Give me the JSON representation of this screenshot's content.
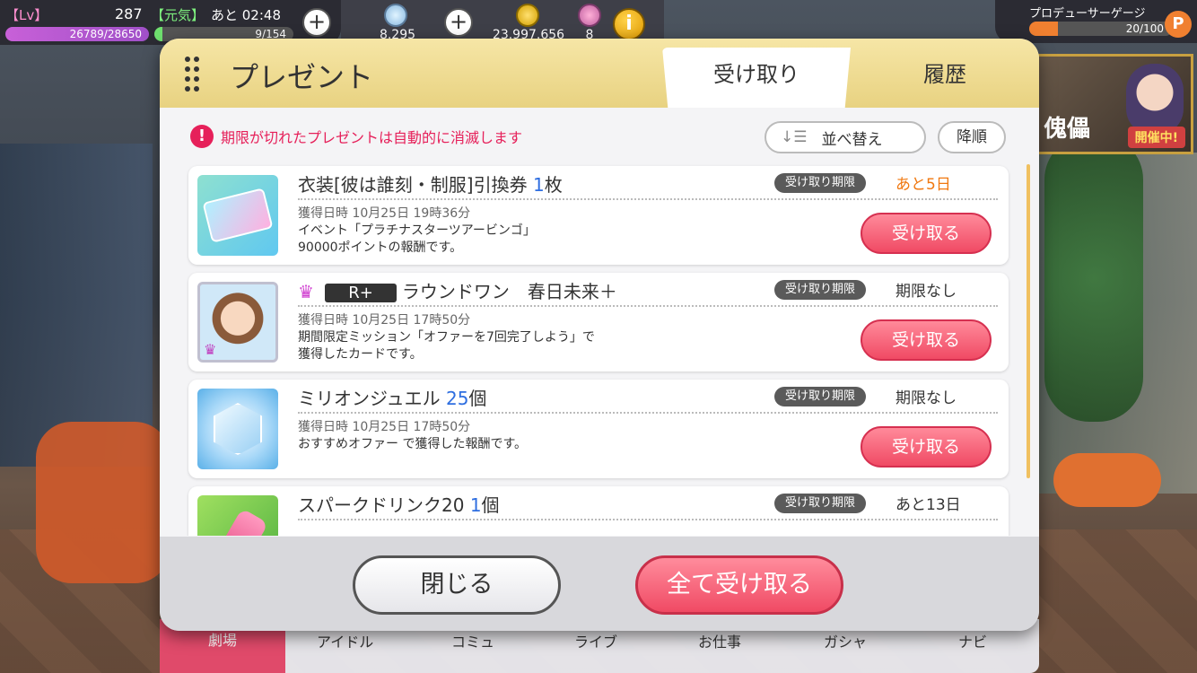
{
  "hud": {
    "lv_label": "【Lv】",
    "level": "287",
    "genki": "【元気】",
    "stamina_time": "あと 02:48",
    "exp": "26789/28650",
    "stamina": "9/154",
    "stamina_fill": 0.06,
    "jewels": "8.295",
    "money": "23.997.656",
    "items": "8",
    "info": "i",
    "gauge_label": "プロデューサーゲージ",
    "gauge_value": "20/100",
    "gauge_fill": 0.2,
    "p_badge": "P"
  },
  "event": {
    "title": "傀儡",
    "live": "開催中!"
  },
  "modal": {
    "title": "プレゼント",
    "tabs": [
      "受け取り",
      "履歴"
    ],
    "warning": "期限が切れたプレゼントは自動的に消滅します",
    "warning_icon": "!",
    "sort_label": "並べ替え",
    "sort_icon": "↓☰",
    "order_label": "降順",
    "close_label": "閉じる",
    "receive_all_label": "全て受け取る"
  },
  "items": [
    {
      "name": "衣装[彼は誰刻・制服]引換券",
      "count": "1",
      "unit": "枚",
      "deadline_tag": "受け取り期限",
      "deadline": "あと5日",
      "date": "獲得日時 10月25日 19時36分",
      "desc1": "イベント「プラチナスターツアービンゴ」",
      "desc2": "90000ポイントの報酬です。",
      "button": "受け取る"
    },
    {
      "rank": "R+",
      "name": "ラウンドワン　春日未来＋",
      "deadline_tag": "受け取り期限",
      "deadline": "期限なし",
      "date": "獲得日時 10月25日 17時50分",
      "desc1": "期間限定ミッション「オファーを7回完了しよう」で",
      "desc2": "獲得したカードです。",
      "button": "受け取る"
    },
    {
      "name": "ミリオンジュエル",
      "count": "25",
      "unit": "個",
      "deadline_tag": "受け取り期限",
      "deadline": "期限なし",
      "date": "獲得日時 10月25日 17時50分",
      "desc1": "おすすめオファー で獲得した報酬です。",
      "button": "受け取る"
    },
    {
      "name": "スパークドリンク20",
      "count": "1",
      "unit": "個",
      "deadline_tag": "受け取り期限",
      "deadline": "あと13日"
    }
  ],
  "nav": [
    "劇場",
    "アイドル",
    "コミュ",
    "ライブ",
    "お仕事",
    "ガシャ",
    "ナビ"
  ],
  "colors": {
    "accent": "#e04a6a",
    "header": "#e8d281",
    "warning": "#e6205a",
    "blue_num": "#2e6ee0"
  }
}
